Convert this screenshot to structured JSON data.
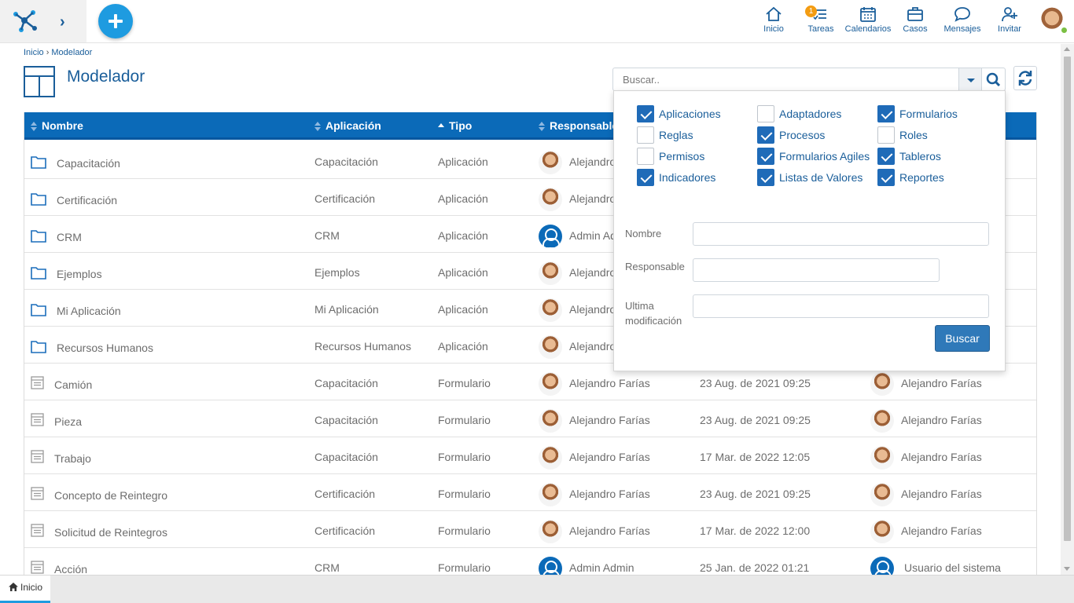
{
  "topbar": {
    "nav": [
      {
        "key": "inicio",
        "label": "Inicio",
        "icon": "home-icon"
      },
      {
        "key": "tareas",
        "label": "Tareas",
        "icon": "tasks-icon",
        "badge": "1"
      },
      {
        "key": "calendarios",
        "label": "Calendarios",
        "icon": "calendar-icon"
      },
      {
        "key": "casos",
        "label": "Casos",
        "icon": "briefcase-icon"
      },
      {
        "key": "mensajes",
        "label": "Mensajes",
        "icon": "chat-icon"
      },
      {
        "key": "invitar",
        "label": "Invitar",
        "icon": "add-user-icon"
      }
    ]
  },
  "breadcrumb": {
    "home": "Inicio",
    "separator": "›",
    "current": "Modelador"
  },
  "page": {
    "title": "Modelador"
  },
  "search": {
    "placeholder": "Buscar.."
  },
  "table": {
    "columns": {
      "nombre": "Nombre",
      "aplicacion": "Aplicación",
      "tipo": "Tipo",
      "responsable": "Responsable"
    },
    "rows": [
      {
        "icon": "folder-icon",
        "nombre": "Capacitación",
        "aplicacion": "Capacitación",
        "tipo": "Aplicación",
        "responsable": "Alejandro",
        "fecha": "",
        "modificado": ""
      },
      {
        "icon": "folder-icon",
        "nombre": "Certificación",
        "aplicacion": "Certificación",
        "tipo": "Aplicación",
        "responsable": "Alejandro",
        "fecha": "",
        "modificado": ""
      },
      {
        "icon": "folder-icon",
        "nombre": "CRM",
        "aplicacion": "CRM",
        "tipo": "Aplicación",
        "responsable": "Admin Ad",
        "fecha": "",
        "modificado": "",
        "admin": true
      },
      {
        "icon": "folder-icon",
        "nombre": "Ejemplos",
        "aplicacion": "Ejemplos",
        "tipo": "Aplicación",
        "responsable": "Alejandro",
        "fecha": "",
        "modificado": ""
      },
      {
        "icon": "folder-icon",
        "nombre": "Mi Aplicación",
        "aplicacion": "Mi Aplicación",
        "tipo": "Aplicación",
        "responsable": "Alejandro",
        "fecha": "",
        "modificado": ""
      },
      {
        "icon": "folder-icon",
        "nombre": "Recursos Humanos",
        "aplicacion": "Recursos Humanos",
        "tipo": "Aplicación",
        "responsable": "Alejandro",
        "fecha": "",
        "modificado": ""
      },
      {
        "icon": "form-icon",
        "nombre": "Camión",
        "aplicacion": "Capacitación",
        "tipo": "Formulario",
        "responsable": "Alejandro Farías",
        "fecha": "23 Aug. de 2021 09:25",
        "modificado": "Alejandro Farías"
      },
      {
        "icon": "form-icon",
        "nombre": "Pieza",
        "aplicacion": "Capacitación",
        "tipo": "Formulario",
        "responsable": "Alejandro Farías",
        "fecha": "23 Aug. de 2021 09:25",
        "modificado": "Alejandro Farías"
      },
      {
        "icon": "form-icon",
        "nombre": "Trabajo",
        "aplicacion": "Capacitación",
        "tipo": "Formulario",
        "responsable": "Alejandro Farías",
        "fecha": "17 Mar. de 2022 12:05",
        "modificado": "Alejandro Farías"
      },
      {
        "icon": "form-icon",
        "nombre": "Concepto de Reintegro",
        "aplicacion": "Certificación",
        "tipo": "Formulario",
        "responsable": "Alejandro Farías",
        "fecha": "23 Aug. de 2021 09:25",
        "modificado": "Alejandro Farías"
      },
      {
        "icon": "form-icon",
        "nombre": "Solicitud de Reintegros",
        "aplicacion": "Certificación",
        "tipo": "Formulario",
        "responsable": "Alejandro Farías",
        "fecha": "17 Mar. de 2022 12:00",
        "modificado": "Alejandro Farías"
      },
      {
        "icon": "form-icon",
        "nombre": "Acción",
        "aplicacion": "CRM",
        "tipo": "Formulario",
        "responsable": "Admin Admin",
        "fecha": "25 Jan. de 2022 01:21",
        "modificado": "Usuario del sistema",
        "admin": true
      }
    ]
  },
  "filter": {
    "checkboxes": [
      {
        "label": "Aplicaciones",
        "checked": true
      },
      {
        "label": "Adaptadores",
        "checked": false
      },
      {
        "label": "Formularios",
        "checked": true
      },
      {
        "label": "Reglas",
        "checked": false
      },
      {
        "label": "Procesos",
        "checked": true
      },
      {
        "label": "Roles",
        "checked": false
      },
      {
        "label": "Permisos",
        "checked": false
      },
      {
        "label": "Formularios Agiles",
        "checked": true
      },
      {
        "label": "Tableros",
        "checked": true
      },
      {
        "label": "Indicadores",
        "checked": true
      },
      {
        "label": "Listas de Valores",
        "checked": true
      },
      {
        "label": "Reportes",
        "checked": true
      }
    ],
    "fields": {
      "nombre_label": "Nombre",
      "nombre_value": "",
      "responsable_label": "Responsable",
      "responsable_value": "",
      "ultima_label": "Ultima modificación",
      "ultima_value": ""
    },
    "submit_label": "Buscar"
  },
  "bottom": {
    "tab_label": "Inicio"
  },
  "colors": {
    "brand": "#1a5e9a",
    "header": "#0b6ab8",
    "accent": "#1e9be0",
    "badge": "#f39c12",
    "online": "#7bc043"
  }
}
